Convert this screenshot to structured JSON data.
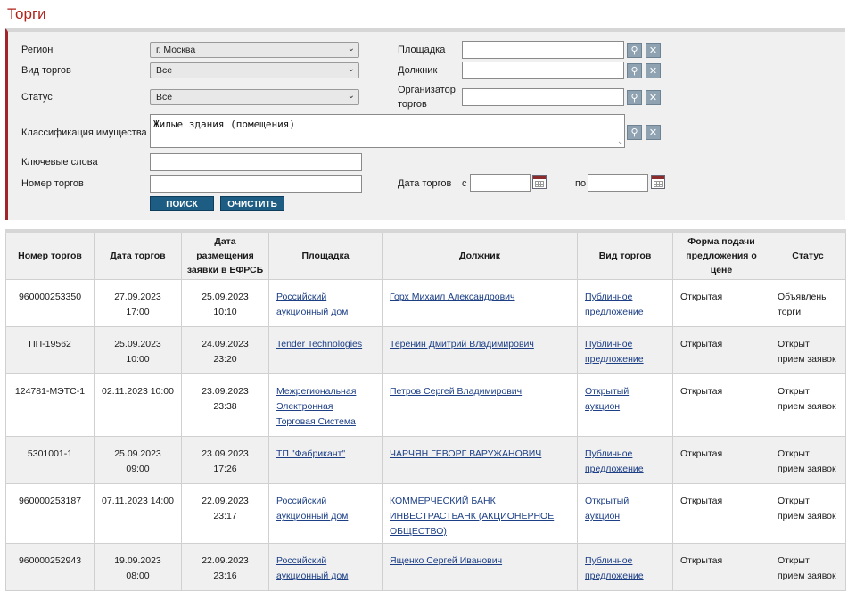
{
  "page": {
    "title": "Торги"
  },
  "filters": {
    "region_label": "Регион",
    "region_value": "г. Москва",
    "trade_type_label": "Вид торгов",
    "trade_type_value": "Все",
    "status_label": "Статус",
    "status_value": "Все",
    "classification_label": "Классификация имущества",
    "classification_value": "Жилые здания (помещения)",
    "keywords_label": "Ключевые слова",
    "keywords_value": "",
    "trade_number_label": "Номер торгов",
    "trade_number_value": "",
    "platform_label": "Площадка",
    "debtor_label": "Должник",
    "organizer_label_1": "Организатор",
    "organizer_label_2": "торгов",
    "trade_date_label": "Дата торгов",
    "date_from_label": "с",
    "date_to_label": "по",
    "search_button": "ПОИСК",
    "clear_button": "ОЧИСТИТЬ"
  },
  "table": {
    "headers": [
      "Номер торгов",
      "Дата торгов",
      "Дата размещения заявки в ЕФРСБ",
      "Площадка",
      "Должник",
      "Вид торгов",
      "Форма подачи предложения о цене",
      "Статус"
    ],
    "rows": [
      {
        "number": "960000253350",
        "trade_date": "27.09.2023 17:00",
        "posted_date": "25.09.2023 10:10",
        "platform": "Российский аукционный дом",
        "debtor": "Горх Михаил Александрович",
        "type": "Публичное предложение",
        "form": "Открытая",
        "status": "Объявлены торги"
      },
      {
        "number": "ПП-19562",
        "trade_date": "25.09.2023 10:00",
        "posted_date": "24.09.2023 23:20",
        "platform": "Tender Technologies",
        "debtor": "Теренин Дмитрий Владимирович",
        "type": "Публичное предложение",
        "form": "Открытая",
        "status": "Открыт прием заявок"
      },
      {
        "number": "124781-МЭТС-1",
        "trade_date": "02.11.2023 10:00",
        "posted_date": "23.09.2023 23:38",
        "platform": "Межрегиональная Электронная Торговая Система",
        "debtor": "Петров Сергей Владимирович",
        "type": "Открытый аукцион",
        "form": "Открытая",
        "status": "Открыт прием заявок"
      },
      {
        "number": "5301001-1",
        "trade_date": "25.09.2023 09:00",
        "posted_date": "23.09.2023 17:26",
        "platform": "ТП \"Фабрикант\"",
        "debtor": "ЧАРЧЯН ГЕВОРГ ВАРУЖАНОВИЧ",
        "type": "Публичное предложение",
        "form": "Открытая",
        "status": "Открыт прием заявок"
      },
      {
        "number": "960000253187",
        "trade_date": "07.11.2023 14:00",
        "posted_date": "22.09.2023 23:17",
        "platform": "Российский аукционный дом",
        "debtor": "КОММЕРЧЕСКИЙ БАНК ИНВЕСТРАСТБАНК (АКЦИОНЕРНОЕ ОБЩЕСТВО)",
        "type": "Открытый аукцион",
        "form": "Открытая",
        "status": "Открыт прием заявок"
      },
      {
        "number": "960000252943",
        "trade_date": "19.09.2023 08:00",
        "posted_date": "22.09.2023 23:16",
        "platform": "Российский аукционный дом",
        "debtor": "Ященко Сергей Иванович",
        "type": "Публичное предложение",
        "form": "Открытая",
        "status": "Открыт прием заявок"
      }
    ]
  },
  "icons": {
    "search": "search-icon",
    "clear": "close-icon",
    "calendar": "calendar-icon",
    "dropdown": "chevron-down-icon"
  }
}
